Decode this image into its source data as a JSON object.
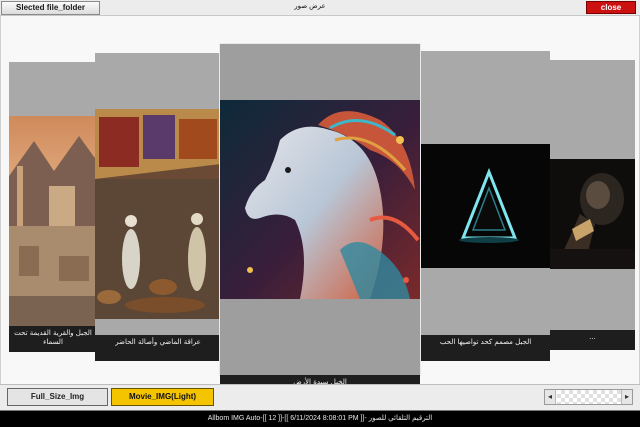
{
  "toolbar": {
    "select_label": "Slected file_folder",
    "window_title": "عرض صور",
    "close_label": "close"
  },
  "gallery": {
    "cards": [
      {
        "caption": "الجبل والقرية القديمة تحت السماء"
      },
      {
        "caption": "عراقة الماضي وأصالة الحاضر"
      },
      {
        "caption": "الخيل سيدة الأرض"
      },
      {
        "caption": "الجبل مصمم كحد تواصيها الحب"
      },
      {
        "caption": "..."
      }
    ]
  },
  "bottom": {
    "full_size_label": "Full_Size_Img",
    "movie_label": "Movie_IMG(Light)",
    "scroll_left": "◂",
    "scroll_right": "▸"
  },
  "status": {
    "text": "Allbom IMG Auto-[[ 12 ]]-[[ 6/11/2024 8:08:01 PM ]]- الترقيم التلقائي للصور"
  },
  "colors": {
    "close_button": "#cc1111",
    "movie_tab": "#f5c400",
    "status_bar": "#000000"
  }
}
